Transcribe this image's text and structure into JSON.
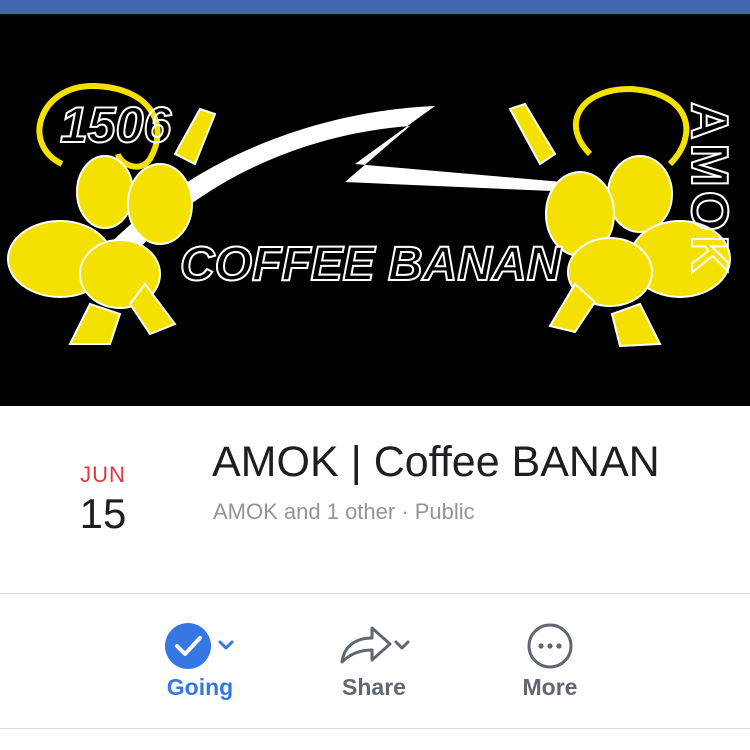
{
  "cover": {
    "number_text": "1506",
    "center_text": "COFFEE BANAN",
    "side_text": "AMOK"
  },
  "event": {
    "month": "JUN",
    "day": "15",
    "title": "AMOK | Coffee BANAN",
    "hosts": "AMOK and 1 other · Public"
  },
  "actions": {
    "going": "Going",
    "share": "Share",
    "more": "More"
  },
  "colors": {
    "header_blue": "#4267b2",
    "accent_blue": "#3578e5",
    "date_red": "#e0393e",
    "cover_yellow": "#f5e100"
  }
}
